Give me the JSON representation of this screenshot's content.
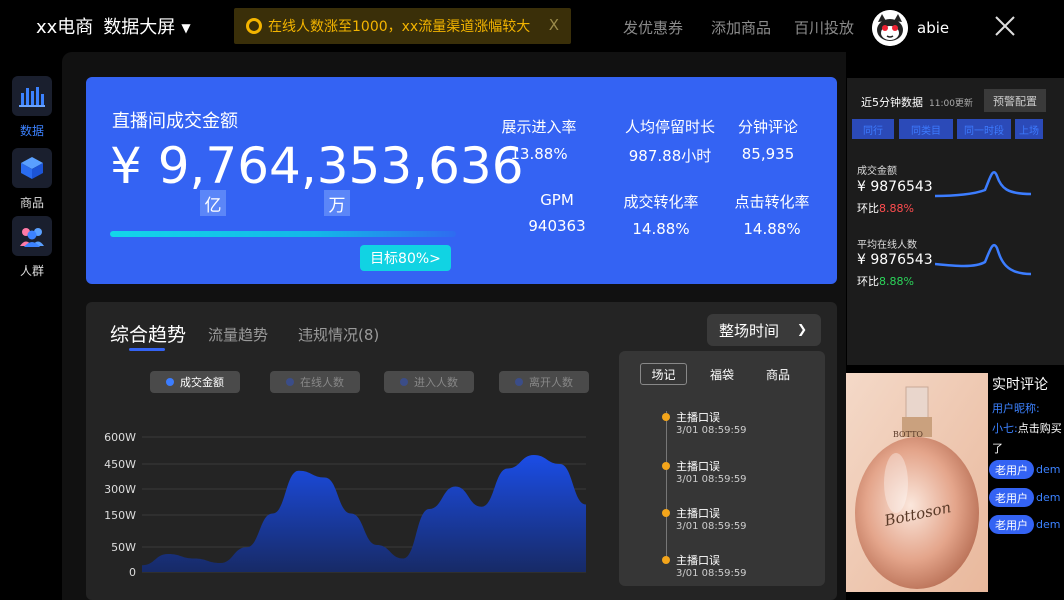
{
  "header": {
    "brand": "xx电商",
    "screen_title": "数据大屏",
    "notice": "在线人数涨至1000，xx流量渠道涨幅较大",
    "notice_close": "X",
    "nav": [
      "发优惠券",
      "添加商品",
      "百川投放"
    ],
    "username": "abie"
  },
  "rail": [
    {
      "label": "数据",
      "icon": "bar-chart-icon",
      "active": true
    },
    {
      "label": "商品",
      "icon": "cube-icon",
      "active": false
    },
    {
      "label": "人群",
      "icon": "users-icon",
      "active": false
    }
  ],
  "hero": {
    "title": "直播间成交金额",
    "amount": "¥ 9,764,353,636",
    "unit_yi": "亿",
    "unit_wan": "万",
    "progress": 0.8,
    "target_label": "目标80%>",
    "metrics": [
      {
        "label": "展示进入率",
        "value": "13.88%"
      },
      {
        "label": "人均停留时长",
        "value": "987.88小时"
      },
      {
        "label": "分钟评论",
        "value": "85,935"
      },
      {
        "label": "GPM",
        "value": "940363"
      },
      {
        "label": "成交转化率",
        "value": "14.88%"
      },
      {
        "label": "点击转化率",
        "value": "14.88%"
      }
    ]
  },
  "trend": {
    "tabs": [
      "综合趋势",
      "流量趋势",
      "违规情况(8)"
    ],
    "dropdown": "整场时间",
    "legend": [
      "成交金额",
      "在线人数",
      "进入人数",
      "离开人数"
    ],
    "y_ticks": [
      "600W",
      "450W",
      "300W",
      "150W",
      "50W",
      "0"
    ]
  },
  "chart_data": {
    "type": "area",
    "series": [
      {
        "name": "成交金额",
        "values": [
          30,
          80,
          60,
          40,
          110,
          260,
          450,
          420,
          260,
          120,
          60,
          280,
          380,
          290,
          460,
          520,
          480,
          300
        ]
      }
    ],
    "y_tick_labels": [
      "600W",
      "450W",
      "300W",
      "150W",
      "50W",
      "0"
    ],
    "ylim": [
      0,
      600
    ],
    "ylabel": "",
    "xlabel": ""
  },
  "record": {
    "tabs": [
      "场记",
      "福袋",
      "商品"
    ],
    "items": [
      {
        "title": "主播口误",
        "time": "3/01 08:59:59"
      },
      {
        "title": "主播口误",
        "time": "3/01 08:59:59"
      },
      {
        "title": "主播口误",
        "time": "3/01 08:59:59"
      },
      {
        "title": "主播口误",
        "time": "3/01 08:59:59"
      }
    ]
  },
  "side": {
    "title": "近5分钟数据",
    "update": "11:00更新",
    "warn_button": "预警配置",
    "tabs": [
      "同行",
      "同类目",
      "同一时段",
      "上场"
    ],
    "kpis": [
      {
        "label": "成交金额",
        "value": "¥ 9876543",
        "change_prefix": "环比",
        "change": "8.88%",
        "change_color": "#ff4d4f"
      },
      {
        "label": "平均在线人数",
        "value": "¥ 9876543",
        "change_prefix": "环比",
        "change": "8.88%",
        "change_color": "#2bd45a"
      }
    ]
  },
  "comments": {
    "title": "实时评论",
    "nickname_label": "用户昵称:",
    "first_user": "小七:",
    "first_text": "点击购买",
    "first_text_wrap": "了",
    "badge": "老用户",
    "after": "dem"
  },
  "product": {
    "brand_top": "BOTTO",
    "script": "Bottoson"
  }
}
